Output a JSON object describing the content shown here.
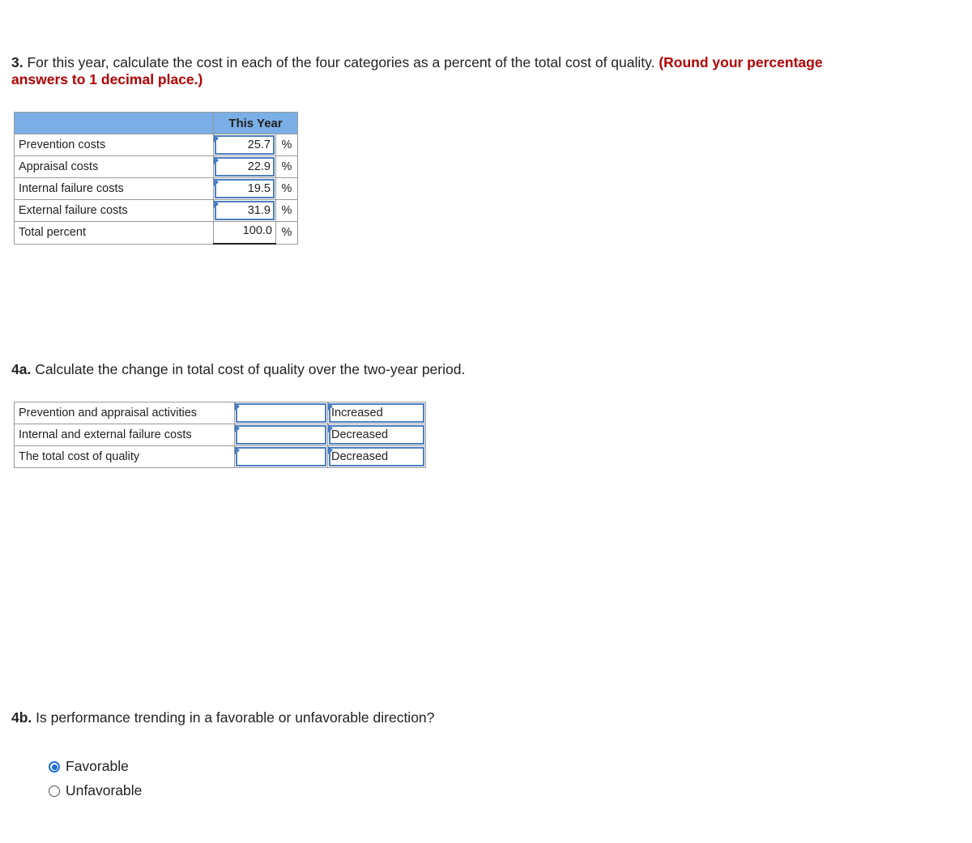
{
  "q3": {
    "number": "3.",
    "text": " For this year, calculate the cost in each of the four categories as a percent of the total cost of quality. ",
    "instruction_line1": "(Round your percentage",
    "instruction_line2": "answers to 1 decimal place.)"
  },
  "table1": {
    "column_header": "This Year",
    "rows": [
      {
        "label": "Prevention costs",
        "value": "25.7",
        "unit": "%"
      },
      {
        "label": "Appraisal costs",
        "value": "22.9",
        "unit": "%"
      },
      {
        "label": "Internal failure costs",
        "value": "19.5",
        "unit": "%"
      },
      {
        "label": "External failure costs",
        "value": "31.9",
        "unit": "%"
      }
    ],
    "total": {
      "label": "Total percent",
      "value": "100.0",
      "unit": "%"
    }
  },
  "q4a": {
    "number": "4a.",
    "text": " Calculate the change in total cost of quality over the two-year period."
  },
  "table2": {
    "rows": [
      {
        "label": "Prevention and appraisal activities",
        "amount": "",
        "direction": "Increased"
      },
      {
        "label": "Internal and external failure costs",
        "amount": "",
        "direction": "Decreased"
      },
      {
        "label": "The total cost of quality",
        "amount": "",
        "direction": "Decreased"
      }
    ]
  },
  "q4b": {
    "number": "4b.",
    "text": " Is performance trending in a favorable or unfavorable direction?",
    "options": [
      {
        "label": "Favorable",
        "selected": true
      },
      {
        "label": "Unfavorable",
        "selected": false
      }
    ]
  },
  "colors": {
    "header_bg": "#7aaee6",
    "input_border": "#4d7fc0",
    "instruction_red": "#b30000",
    "radio_selected": "#1f6fe0"
  }
}
